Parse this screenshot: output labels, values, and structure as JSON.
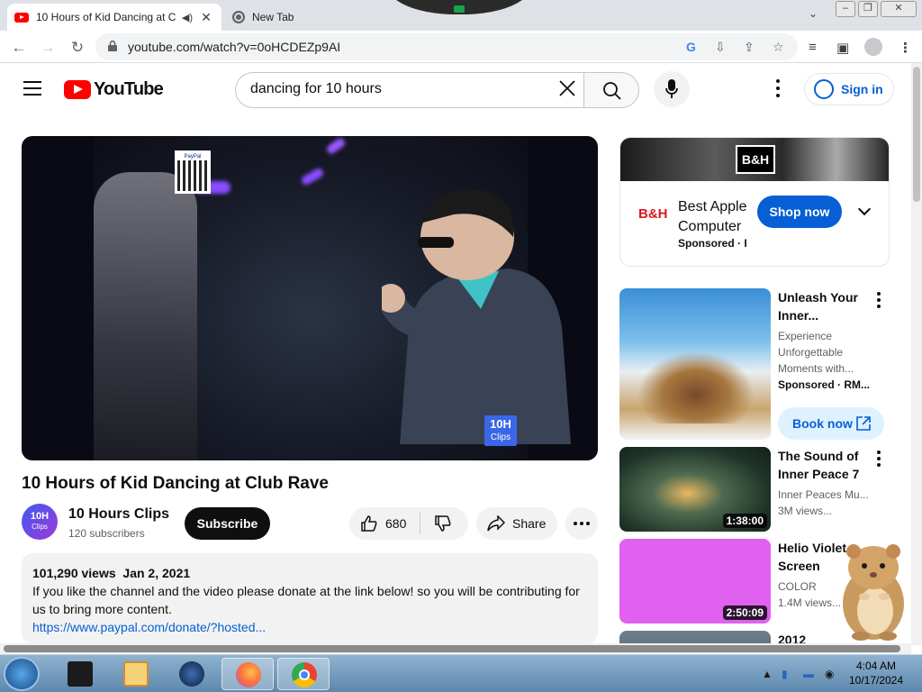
{
  "browser": {
    "tabs": [
      {
        "title": "10 Hours of Kid Dancing at C",
        "active": true,
        "favicon": "youtube-icon"
      },
      {
        "title": "New Tab",
        "active": false,
        "favicon": "chrome-icon"
      }
    ],
    "url": "youtube.com/watch?v=0oHCDEZp9AI"
  },
  "header": {
    "logo_text": "YouTube",
    "search_value": "dancing for 10 hours",
    "signin_label": "Sign in"
  },
  "video": {
    "title": "10 Hours of Kid Dancing at Club Rave",
    "badge_top": "10H",
    "badge_bottom": "Clips",
    "paypal_label": "PayPal"
  },
  "channel": {
    "avatar_top": "10H",
    "avatar_bottom": "Clips",
    "name": "10 Hours Clips",
    "subscribers": "120 subscribers",
    "subscribe_label": "Subscribe"
  },
  "actions": {
    "likes": "680",
    "share_label": "Share"
  },
  "description": {
    "views": "101,290 views",
    "date": "Jan 2, 2021",
    "text": "If you like the channel and the video please donate at the link below! so you will be contributing for us to bring more content.",
    "link": "https://www.paypal.com/donate/?hosted..."
  },
  "ad": {
    "banner_logo": "B&H",
    "brand_icon": "B&H",
    "title_line1": "Best Apple",
    "title_line2": "Computer",
    "sponsored": "Sponsored · I",
    "cta": "Shop now"
  },
  "recommendations": [
    {
      "title": "Unleash Your Inner...",
      "lines": [
        "Experience",
        "Unforgettable",
        "Moments with..."
      ],
      "sponsored": "Sponsored · RM...",
      "cta": "Book now"
    },
    {
      "title": "The Sound of Inner Peace 7 ...",
      "channel": "Inner Peaces Mu...",
      "views": "3M views...",
      "duration": "1:38:00"
    },
    {
      "title": "Helio Violet Screen",
      "channel": "COLOR",
      "views": "1.4M views...",
      "duration": "2:50:09"
    },
    {
      "title": "2012"
    }
  ],
  "taskbar": {
    "time": "4:04 AM",
    "date": "10/17/2024"
  },
  "colors": {
    "youtube_red": "#ff0000",
    "link_blue": "#065fd4",
    "violet_thumb": "#e060f0"
  }
}
